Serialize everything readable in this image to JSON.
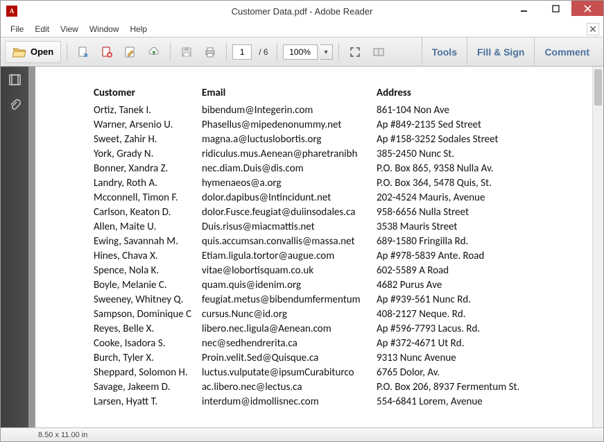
{
  "window": {
    "title": "Customer Data.pdf - Adobe Reader"
  },
  "menu": {
    "items": [
      "File",
      "Edit",
      "View",
      "Window",
      "Help"
    ]
  },
  "toolbar": {
    "open_label": "Open",
    "current_page": "1",
    "page_separator": "/ 6",
    "zoom_value": "100%"
  },
  "panels": {
    "tools": "Tools",
    "fillsign": "Fill & Sign",
    "comment": "Comment"
  },
  "table": {
    "headers": {
      "customer": "Customer",
      "email": "Email",
      "address": "Address"
    },
    "rows": [
      {
        "c": "Ortiz, Tanek I.",
        "e": "bibendum@Integerin.com",
        "a": "861-104 Non Ave"
      },
      {
        "c": "Warner, Arsenio U.",
        "e": "Phasellus@mipedenonummy.net",
        "a": "Ap #849-2135 Sed Street"
      },
      {
        "c": "Sweet, Zahir H.",
        "e": "magna.a@luctuslobortis.org",
        "a": "Ap #158-3252 Sodales Street"
      },
      {
        "c": "York, Grady N.",
        "e": "ridiculus.mus.Aenean@pharetranibh",
        "a": "385-2450 Nunc St."
      },
      {
        "c": "Bonner, Xandra Z.",
        "e": "nec.diam.Duis@dis.com",
        "a": "P.O. Box 865, 9358 Nulla Av."
      },
      {
        "c": "Landry, Roth A.",
        "e": "hymenaeos@a.org",
        "a": "P.O. Box 364, 5478 Quis, St."
      },
      {
        "c": "Mcconnell, Timon F.",
        "e": "dolor.dapibus@Intincidunt.net",
        "a": "202-4524 Mauris, Avenue"
      },
      {
        "c": "Carlson, Keaton D.",
        "e": "dolor.Fusce.feugiat@duiinsodales.ca",
        "a": "958-6656 Nulla Street"
      },
      {
        "c": "Allen, Maite U.",
        "e": "Duis.risus@miacmattis.net",
        "a": "3538 Mauris Street"
      },
      {
        "c": "Ewing, Savannah M.",
        "e": "quis.accumsan.convallis@massa.net",
        "a": "689-1580 Fringilla Rd."
      },
      {
        "c": "Hines, Chava X.",
        "e": "Etiam.ligula.tortor@augue.com",
        "a": "Ap #978-5839 Ante. Road"
      },
      {
        "c": "Spence, Nola K.",
        "e": "vitae@lobortisquam.co.uk",
        "a": "602-5589 A Road"
      },
      {
        "c": "Boyle, Melanie C.",
        "e": "quam.quis@idenim.org",
        "a": "4682 Purus Ave"
      },
      {
        "c": "Sweeney, Whitney Q.",
        "e": "feugiat.metus@bibendumfermentum",
        "a": "Ap #939-561 Nunc Rd."
      },
      {
        "c": "Sampson, Dominique C",
        "e": "cursus.Nunc@id.org",
        "a": "408-2127 Neque. Rd."
      },
      {
        "c": "Reyes, Belle X.",
        "e": "libero.nec.ligula@Aenean.com",
        "a": "Ap #596-7793 Lacus. Rd."
      },
      {
        "c": "Cooke, Isadora S.",
        "e": "nec@sedhendrerita.ca",
        "a": "Ap #372-4671 Ut Rd."
      },
      {
        "c": "Burch, Tyler X.",
        "e": "Proin.velit.Sed@Quisque.ca",
        "a": "9313 Nunc Avenue"
      },
      {
        "c": "Sheppard, Solomon H.",
        "e": "luctus.vulputate@ipsumCurabiturco",
        "a": "6765 Dolor, Av."
      },
      {
        "c": "Savage, Jakeem D.",
        "e": "ac.libero.nec@lectus.ca",
        "a": "P.O. Box 206, 8937 Fermentum St."
      },
      {
        "c": "Larsen, Hyatt T.",
        "e": "interdum@idmollisnec.com",
        "a": "554-6841 Lorem, Avenue"
      }
    ]
  },
  "status": {
    "page_dims": "8.50 x 11.00 in"
  }
}
